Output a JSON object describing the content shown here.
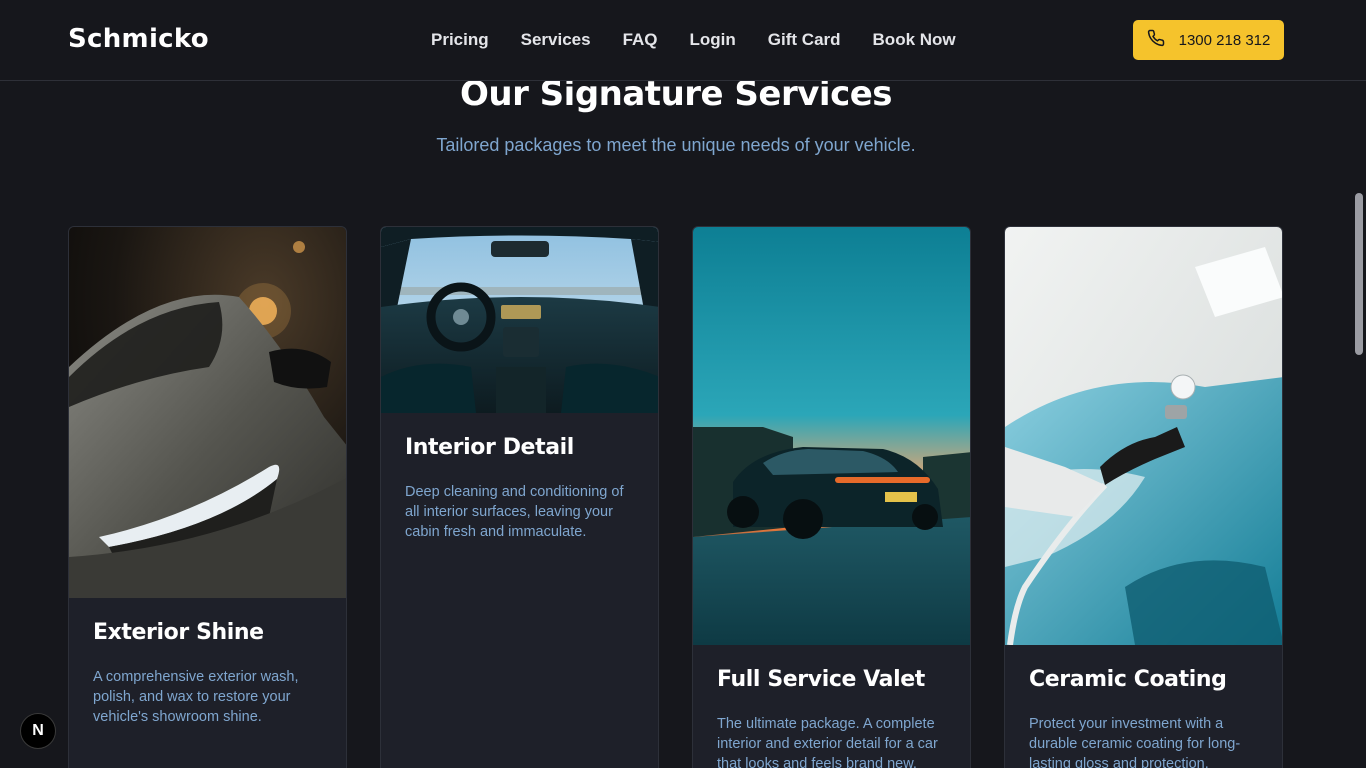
{
  "header": {
    "brand": "Schmicko",
    "nav": [
      "Pricing",
      "Services",
      "FAQ",
      "Login",
      "Gift Card",
      "Book Now"
    ],
    "phone": "1300 218 312",
    "phone_icon": "phone-icon",
    "accent_color": "#f5c32c"
  },
  "section": {
    "title": "Our Signature Services",
    "subtitle": "Tailored packages to meet the unique needs of your vehicle."
  },
  "cards": [
    {
      "title": "Exterior Shine",
      "desc": "A comprehensive exterior wash, polish, and wax to restore your vehicle's showroom shine."
    },
    {
      "title": "Interior Detail",
      "desc": "Deep cleaning and conditioning of all interior surfaces, leaving your cabin fresh and immaculate."
    },
    {
      "title": "Full Service Valet",
      "desc": "The ultimate package. A complete interior and exterior detail for a car that looks and feels brand new."
    },
    {
      "title": "Ceramic Coating",
      "desc": "Protect your investment with a durable ceramic coating for long-lasting gloss and protection."
    }
  ],
  "badge": "N"
}
